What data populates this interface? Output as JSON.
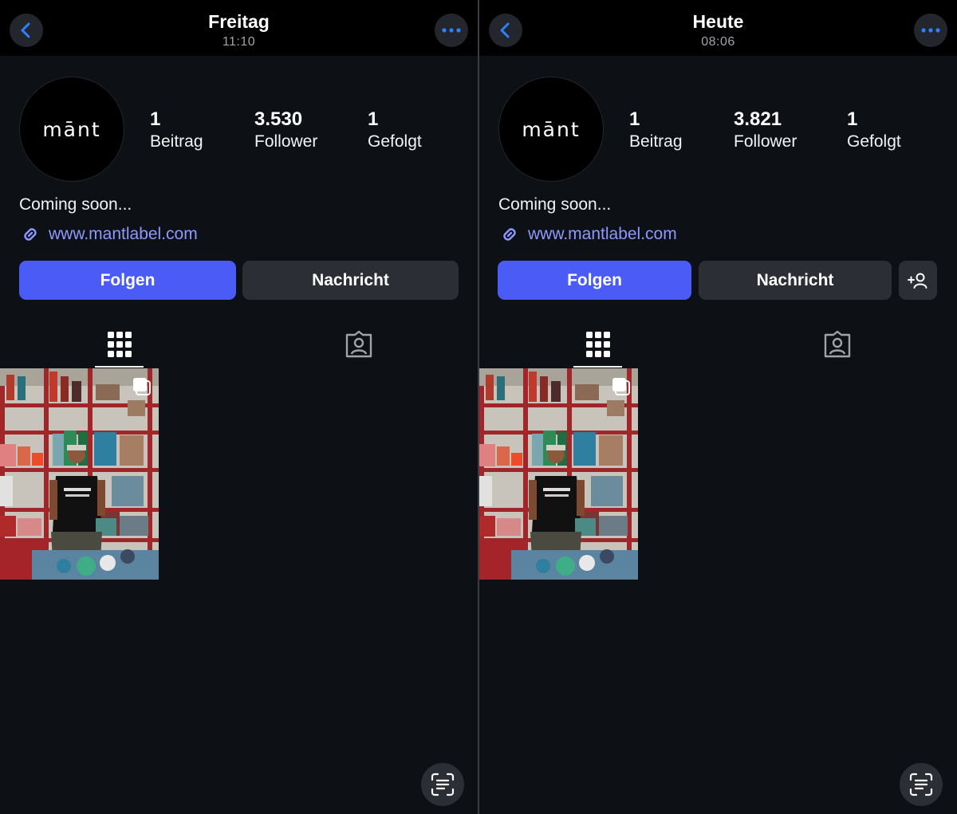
{
  "panels": [
    {
      "header": {
        "title": "Freitag",
        "subtitle": "11:10"
      },
      "profile": {
        "avatar_text": "mānt",
        "stats": [
          {
            "number": "1",
            "label": "Beitrag"
          },
          {
            "number": "3.530",
            "label": "Follower"
          },
          {
            "number": "1",
            "label": "Gefolgt"
          }
        ],
        "bio": "Coming soon...",
        "link": "www.mantlabel.com"
      },
      "actions": {
        "follow": "Folgen",
        "message": "Nachricht",
        "has_add_person": false
      },
      "icons": [
        "chevron-left-icon",
        "more-horizontal-icon",
        "link-icon",
        "grid-icon",
        "tagged-person-icon",
        "carousel-icon",
        "scan-text-icon"
      ]
    },
    {
      "header": {
        "title": "Heute",
        "subtitle": "08:06"
      },
      "profile": {
        "avatar_text": "mānt",
        "stats": [
          {
            "number": "1",
            "label": "Beitrag"
          },
          {
            "number": "3.821",
            "label": "Follower"
          },
          {
            "number": "1",
            "label": "Gefolgt"
          }
        ],
        "bio": "Coming soon...",
        "link": "www.mantlabel.com"
      },
      "actions": {
        "follow": "Folgen",
        "message": "Nachricht",
        "has_add_person": true
      },
      "icons": [
        "chevron-left-icon",
        "more-horizontal-icon",
        "link-icon",
        "grid-icon",
        "tagged-person-icon",
        "carousel-icon",
        "scan-text-icon",
        "add-person-icon"
      ]
    }
  ],
  "colors": {
    "background": "#0d1015",
    "topbar": "#000000",
    "accent_blue": "#4a5cf5",
    "link": "#8e99ff",
    "button_gray": "#2b2e35",
    "icon_blue": "#2f80ff"
  }
}
